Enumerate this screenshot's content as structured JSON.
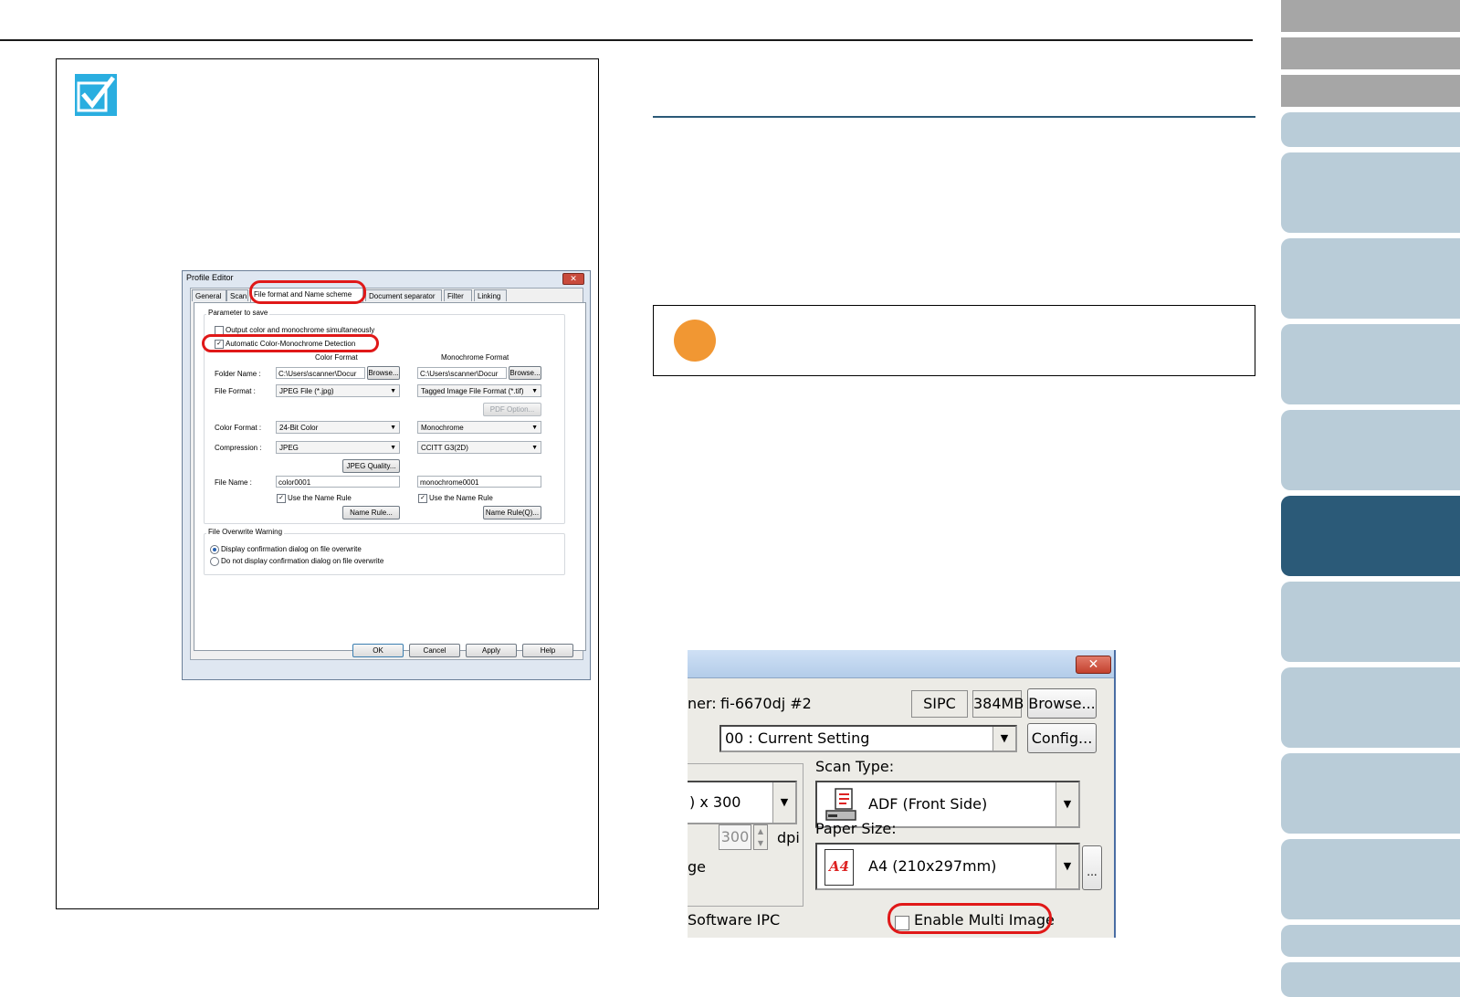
{
  "nav": {
    "tabs": [
      "",
      "",
      "",
      "",
      "",
      "",
      "",
      "",
      "",
      "",
      "",
      "",
      "",
      ""
    ],
    "active_index": 6
  },
  "profile_editor": {
    "title": "Profile Editor",
    "close_glyph": "✕",
    "tabs": [
      "General",
      "Scan",
      "File format and Name scheme",
      "Document separator",
      "Filter",
      "Linking"
    ],
    "group_parameter": "Parameter to save",
    "chk_output_simultaneous": "Output color and monochrome simultaneously",
    "chk_auto_detection": "Automatic Color-Monochrome Detection",
    "col_color_format": "Color Format",
    "col_mono_format": "Monochrome Format",
    "folder_name_label": "Folder Name :",
    "folder_color_value": "C:\\Users\\scanner\\Docur",
    "folder_mono_value": "C:\\Users\\scanner\\Docur",
    "browse_label": "Browse...",
    "file_format_label": "File Format :",
    "file_format_color": "JPEG File (*.jpg)",
    "file_format_mono": "Tagged Image File Format (*.tif)",
    "pdf_option_label": "PDF Option...",
    "color_format_label": "Color Format :",
    "color_format_color": "24-Bit Color",
    "color_format_mono": "Monochrome",
    "compression_label": "Compression :",
    "compression_color": "JPEG",
    "compression_mono": "CCITT G3(2D)",
    "jpeg_quality_label": "JPEG Quality...",
    "file_name_label": "File Name :",
    "file_name_color": "color0001",
    "file_name_mono": "monochrome0001",
    "use_name_rule": "Use the Name Rule",
    "name_rule_label": "Name Rule...",
    "name_rule_q_label": "Name Rule(Q)...",
    "group_overwrite": "File Overwrite Warning",
    "radio_display": "Display confirmation dialog on file overwrite",
    "radio_no_display": "Do not display confirmation dialog on file overwrite",
    "ok_label": "OK",
    "cancel_label": "Cancel",
    "apply_label": "Apply",
    "help_label": "Help"
  },
  "scanner_dialog": {
    "close_glyph": "✕",
    "scanner_label": "ner:",
    "scanner_value": "fi-6670dj #2",
    "sipc": "SIPC",
    "memory": "384MB",
    "browse_label": "Browse...",
    "profile_value": "00 : Current Setting",
    "config_label": "Config...",
    "scan_type_label": "Scan Type:",
    "scan_type_value": "ADF (Front Side)",
    "resolution_value": ") x 300",
    "custom_dpi_value": "300",
    "dpi_label": "dpi",
    "paper_size_label": "Paper Size:",
    "paper_icon_text": "A4",
    "paper_size_value": "A4 (210x297mm)",
    "more_label": "...",
    "image_label_fragment": "ge",
    "software_ipc_label": "Software IPC",
    "enable_multi_image": "Enable Multi Image"
  }
}
